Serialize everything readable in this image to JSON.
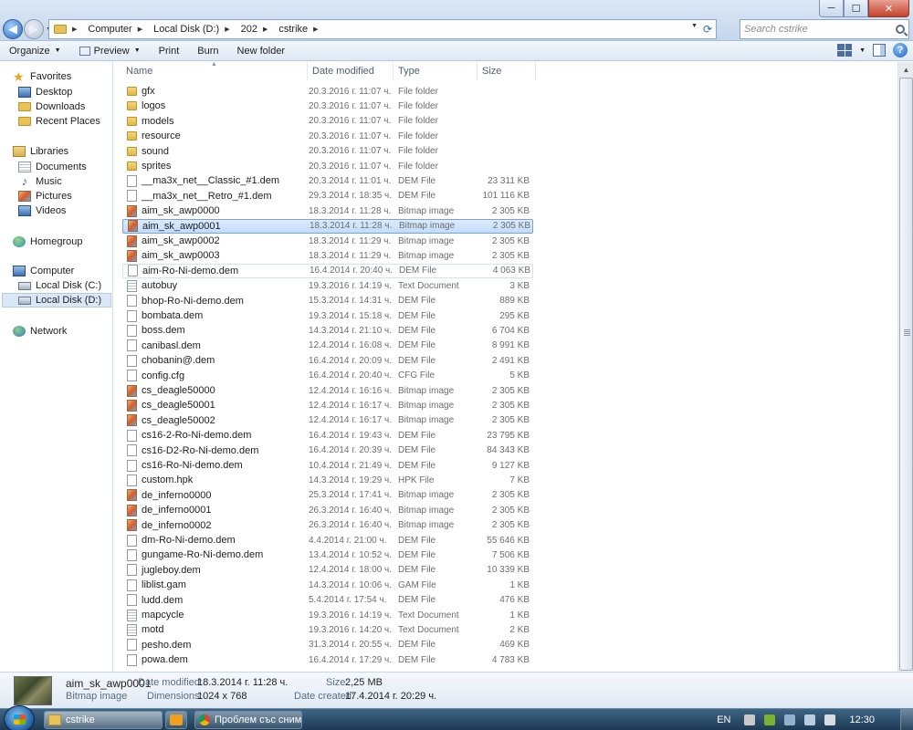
{
  "window": {
    "minimize": "─",
    "maximize": "☐",
    "close": "✕"
  },
  "address": {
    "crumbs": [
      "Computer",
      "Local Disk (D:)",
      "202",
      "cstrike"
    ],
    "search_placeholder": "Search cstrike"
  },
  "commands": {
    "organize": "Organize",
    "preview": "Preview",
    "print": "Print",
    "burn": "Burn",
    "new_folder": "New folder"
  },
  "nav": {
    "favorites": "Favorites",
    "desktop": "Desktop",
    "downloads": "Downloads",
    "recent": "Recent Places",
    "libraries": "Libraries",
    "documents": "Documents",
    "music": "Music",
    "pictures": "Pictures",
    "videos": "Videos",
    "homegroup": "Homegroup",
    "computer": "Computer",
    "disk_c": "Local Disk (C:)",
    "disk_d": "Local Disk (D:)",
    "network": "Network"
  },
  "columns": {
    "name": "Name",
    "date": "Date modified",
    "type": "Type",
    "size": "Size"
  },
  "files": [
    {
      "name": "gfx",
      "date": "20.3.2016 г. 11:07 ч.",
      "type": "File folder",
      "size": "",
      "icon": "folder"
    },
    {
      "name": "logos",
      "date": "20.3.2016 г. 11:07 ч.",
      "type": "File folder",
      "size": "",
      "icon": "folder"
    },
    {
      "name": "models",
      "date": "20.3.2016 г. 11:07 ч.",
      "type": "File folder",
      "size": "",
      "icon": "folder"
    },
    {
      "name": "resource",
      "date": "20.3.2016 г. 11:07 ч.",
      "type": "File folder",
      "size": "",
      "icon": "folder"
    },
    {
      "name": "sound",
      "date": "20.3.2016 г. 11:07 ч.",
      "type": "File folder",
      "size": "",
      "icon": "folder"
    },
    {
      "name": "sprites",
      "date": "20.3.2016 г. 11:07 ч.",
      "type": "File folder",
      "size": "",
      "icon": "folder"
    },
    {
      "name": "__ma3x_net__Classic_#1.dem",
      "date": "20.3.2014 г. 11:01 ч.",
      "type": "DEM File",
      "size": "23 311 KB",
      "icon": "file"
    },
    {
      "name": "__ma3x_net__Retro_#1.dem",
      "date": "29.3.2014 г. 18:35 ч.",
      "type": "DEM File",
      "size": "101 116 KB",
      "icon": "file"
    },
    {
      "name": "aim_sk_awp0000",
      "date": "18.3.2014 г. 11:28 ч.",
      "type": "Bitmap image",
      "size": "2 305 KB",
      "icon": "bmp"
    },
    {
      "name": "aim_sk_awp0001",
      "date": "18.3.2014 г. 11:28 ч.",
      "type": "Bitmap image",
      "size": "2 305 KB",
      "icon": "bmp"
    },
    {
      "name": "aim_sk_awp0002",
      "date": "18.3.2014 г. 11:29 ч.",
      "type": "Bitmap image",
      "size": "2 305 KB",
      "icon": "bmp"
    },
    {
      "name": "aim_sk_awp0003",
      "date": "18.3.2014 г. 11:29 ч.",
      "type": "Bitmap image",
      "size": "2 305 KB",
      "icon": "bmp"
    },
    {
      "name": "aim-Ro-Ni-demo.dem",
      "date": "16.4.2014 г. 20:40 ч.",
      "type": "DEM File",
      "size": "4 063 KB",
      "icon": "file"
    },
    {
      "name": "autobuy",
      "date": "19.3.2016 г. 14:19 ч.",
      "type": "Text Document",
      "size": "3 KB",
      "icon": "txt"
    },
    {
      "name": "bhop-Ro-Ni-demo.dem",
      "date": "15.3.2014 г. 14:31 ч.",
      "type": "DEM File",
      "size": "889 KB",
      "icon": "file"
    },
    {
      "name": "bombata.dem",
      "date": "19.3.2014 г. 15:18 ч.",
      "type": "DEM File",
      "size": "295 KB",
      "icon": "file"
    },
    {
      "name": "boss.dem",
      "date": "14.3.2014 г. 21:10 ч.",
      "type": "DEM File",
      "size": "6 704 KB",
      "icon": "file"
    },
    {
      "name": "canibasl.dem",
      "date": "12.4.2014 г. 16:08 ч.",
      "type": "DEM File",
      "size": "8 991 KB",
      "icon": "file"
    },
    {
      "name": "chobanin@.dem",
      "date": "16.4.2014 г. 20:09 ч.",
      "type": "DEM File",
      "size": "2 491 KB",
      "icon": "file"
    },
    {
      "name": "config.cfg",
      "date": "16.4.2014 г. 20:40 ч.",
      "type": "CFG File",
      "size": "5 KB",
      "icon": "file"
    },
    {
      "name": "cs_deagle50000",
      "date": "12.4.2014 г. 16:16 ч.",
      "type": "Bitmap image",
      "size": "2 305 KB",
      "icon": "bmp"
    },
    {
      "name": "cs_deagle50001",
      "date": "12.4.2014 г. 16:17 ч.",
      "type": "Bitmap image",
      "size": "2 305 KB",
      "icon": "bmp"
    },
    {
      "name": "cs_deagle50002",
      "date": "12.4.2014 г. 16:17 ч.",
      "type": "Bitmap image",
      "size": "2 305 KB",
      "icon": "bmp"
    },
    {
      "name": "cs16-2-Ro-Ni-demo.dem",
      "date": "16.4.2014 г. 19:43 ч.",
      "type": "DEM File",
      "size": "23 795 KB",
      "icon": "file"
    },
    {
      "name": "cs16-D2-Ro-Ni-demo.dem",
      "date": "16.4.2014 г. 20:39 ч.",
      "type": "DEM File",
      "size": "84 343 KB",
      "icon": "file"
    },
    {
      "name": "cs16-Ro-Ni-demo.dem",
      "date": "10.4.2014 г. 21:49 ч.",
      "type": "DEM File",
      "size": "9 127 KB",
      "icon": "file"
    },
    {
      "name": "custom.hpk",
      "date": "14.3.2014 г. 19:29 ч.",
      "type": "HPK File",
      "size": "7 KB",
      "icon": "file"
    },
    {
      "name": "de_inferno0000",
      "date": "25.3.2014 г. 17:41 ч.",
      "type": "Bitmap image",
      "size": "2 305 KB",
      "icon": "bmp"
    },
    {
      "name": "de_inferno0001",
      "date": "26.3.2014 г. 16:40 ч.",
      "type": "Bitmap image",
      "size": "2 305 KB",
      "icon": "bmp"
    },
    {
      "name": "de_inferno0002",
      "date": "26.3.2014 г. 16:40 ч.",
      "type": "Bitmap image",
      "size": "2 305 KB",
      "icon": "bmp"
    },
    {
      "name": "dm-Ro-Ni-demo.dem",
      "date": "4.4.2014 г. 21:00 ч.",
      "type": "DEM File",
      "size": "55 646 KB",
      "icon": "file"
    },
    {
      "name": "gungame-Ro-Ni-demo.dem",
      "date": "13.4.2014 г. 10:52 ч.",
      "type": "DEM File",
      "size": "7 506 KB",
      "icon": "file"
    },
    {
      "name": "jugleboy.dem",
      "date": "12.4.2014 г. 18:00 ч.",
      "type": "DEM File",
      "size": "10 339 KB",
      "icon": "file"
    },
    {
      "name": "liblist.gam",
      "date": "14.3.2014 г. 10:06 ч.",
      "type": "GAM File",
      "size": "1 KB",
      "icon": "file"
    },
    {
      "name": "ludd.dem",
      "date": "5.4.2014 г. 17:54 ч.",
      "type": "DEM File",
      "size": "476 KB",
      "icon": "file"
    },
    {
      "name": "mapcycle",
      "date": "19.3.2016 г. 14:19 ч.",
      "type": "Text Document",
      "size": "1 KB",
      "icon": "txt"
    },
    {
      "name": "motd",
      "date": "19.3.2016 г. 14:20 ч.",
      "type": "Text Document",
      "size": "2 KB",
      "icon": "txt"
    },
    {
      "name": "pesho.dem",
      "date": "31.3.2014 г. 20:55 ч.",
      "type": "DEM File",
      "size": "469 KB",
      "icon": "file"
    },
    {
      "name": "powa.dem",
      "date": "16.4.2014 г. 17:29 ч.",
      "type": "DEM File",
      "size": "4 783 KB",
      "icon": "file"
    }
  ],
  "selected_index": 9,
  "details": {
    "name": "aim_sk_awp0001",
    "type": "Bitmap image",
    "date_modified_label": "Date modified:",
    "date_modified": "18.3.2014 г. 11:28 ч.",
    "dimensions_label": "Dimensions:",
    "dimensions": "1024 x 768",
    "size_label": "Size:",
    "size": "2,25 MB",
    "date_created_label": "Date created:",
    "date_created": "17.4.2014 г. 20:29 ч."
  },
  "taskbar": {
    "task_explorer": "cstrike",
    "task_chrome": "Проблем със сним...",
    "lang": "EN",
    "time": "12:30"
  }
}
